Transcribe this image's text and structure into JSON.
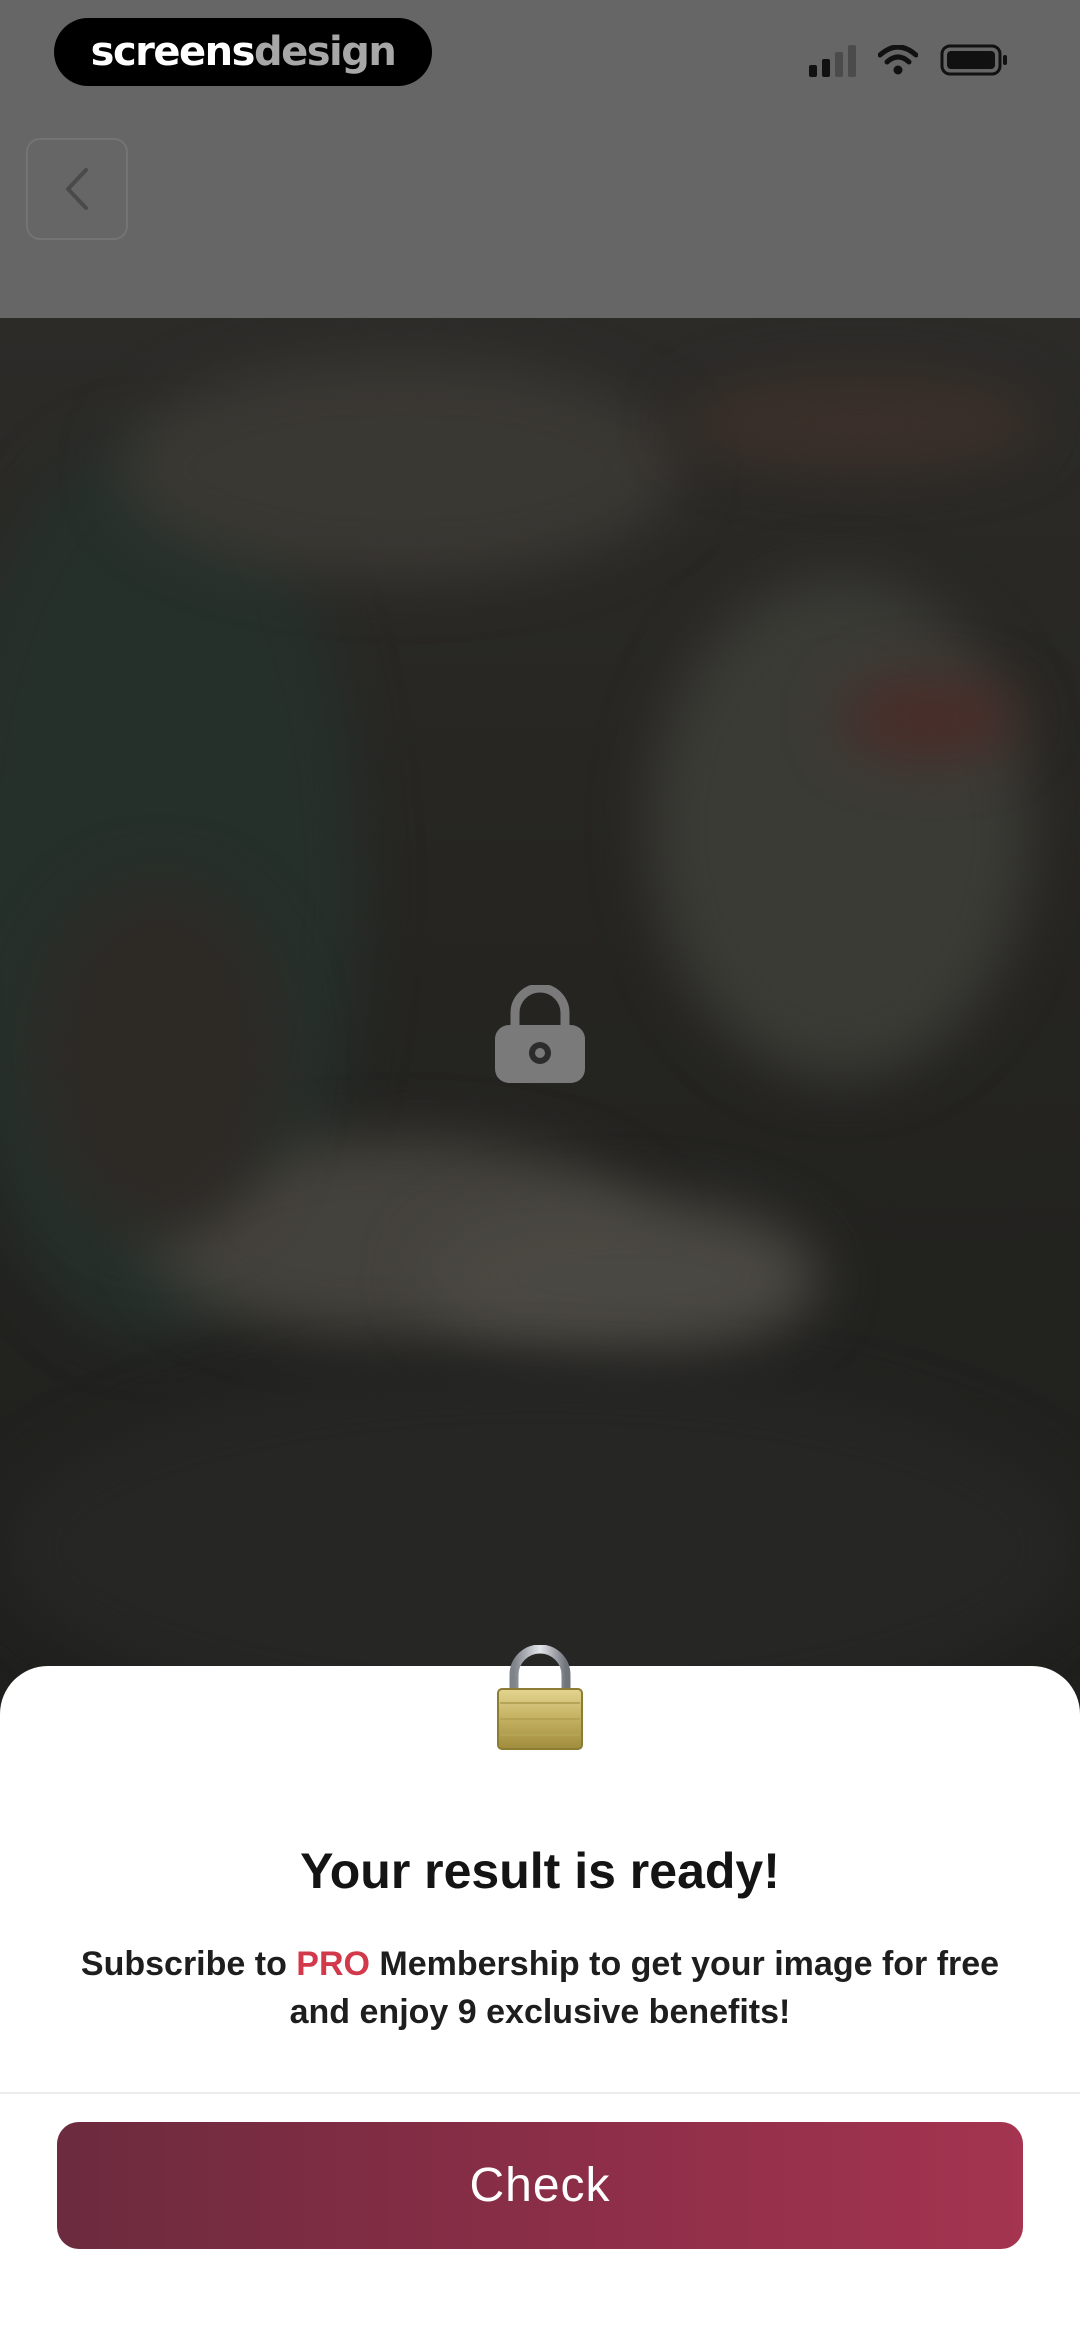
{
  "watermark": {
    "brand_part1": "screens",
    "brand_part2": "design"
  },
  "status_bar": {
    "signal_icon": "cellular-signal-icon",
    "wifi_icon": "wifi-icon",
    "battery_icon": "battery-icon"
  },
  "nav": {
    "back_icon": "chevron-left-icon"
  },
  "preview": {
    "lock_icon": "lock-icon"
  },
  "sheet": {
    "lock_emoji": "padlock-icon",
    "title": "Your result is ready!",
    "subtitle_before": "Subscribe to ",
    "subtitle_highlight": "PRO",
    "subtitle_after": " Membership to get your image for free and enjoy 9 exclusive benefits!",
    "button_label": "Check"
  },
  "colors": {
    "accent_pro": "#d23a4b",
    "button_gradient_start": "#6c2b3e",
    "button_gradient_end": "#a43450"
  }
}
